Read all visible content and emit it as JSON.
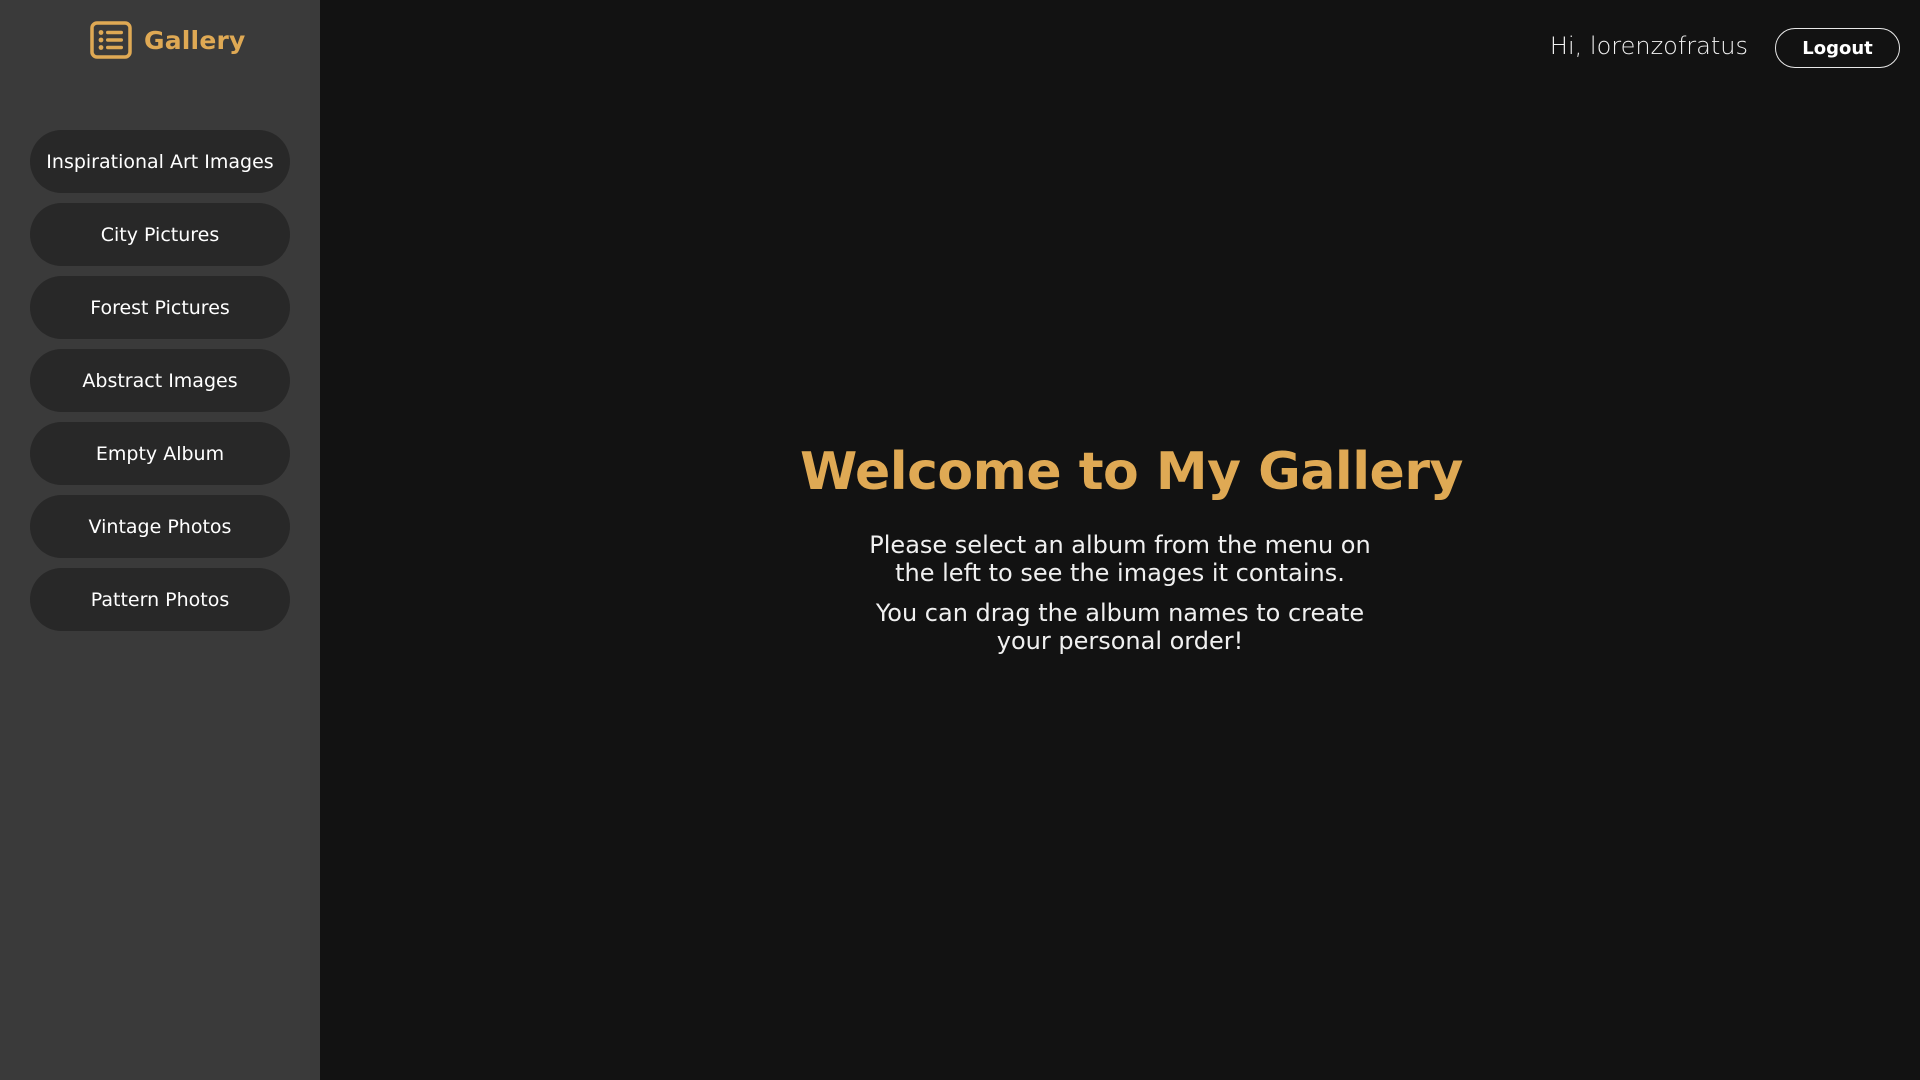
{
  "brand": {
    "title": "Gallery",
    "icon": "list-icon",
    "accent_color": "#dfa954"
  },
  "sidebar": {
    "albums": [
      {
        "label": "Inspirational Art Images"
      },
      {
        "label": "City Pictures"
      },
      {
        "label": "Forest Pictures"
      },
      {
        "label": "Abstract Images"
      },
      {
        "label": "Empty Album"
      },
      {
        "label": "Vintage Photos"
      },
      {
        "label": "Pattern Photos"
      }
    ]
  },
  "header": {
    "greeting": "Hi, lorenzofratus",
    "logout_label": "Logout"
  },
  "main": {
    "title": "Welcome to My Gallery",
    "paragraph1": "Please select an album from the menu on the left to see the images it contains.",
    "paragraph2": "You can drag the album names to create your personal order!"
  },
  "colors": {
    "background": "#121212",
    "sidebar": "#3a3a3a",
    "album_button": "#282828"
  }
}
